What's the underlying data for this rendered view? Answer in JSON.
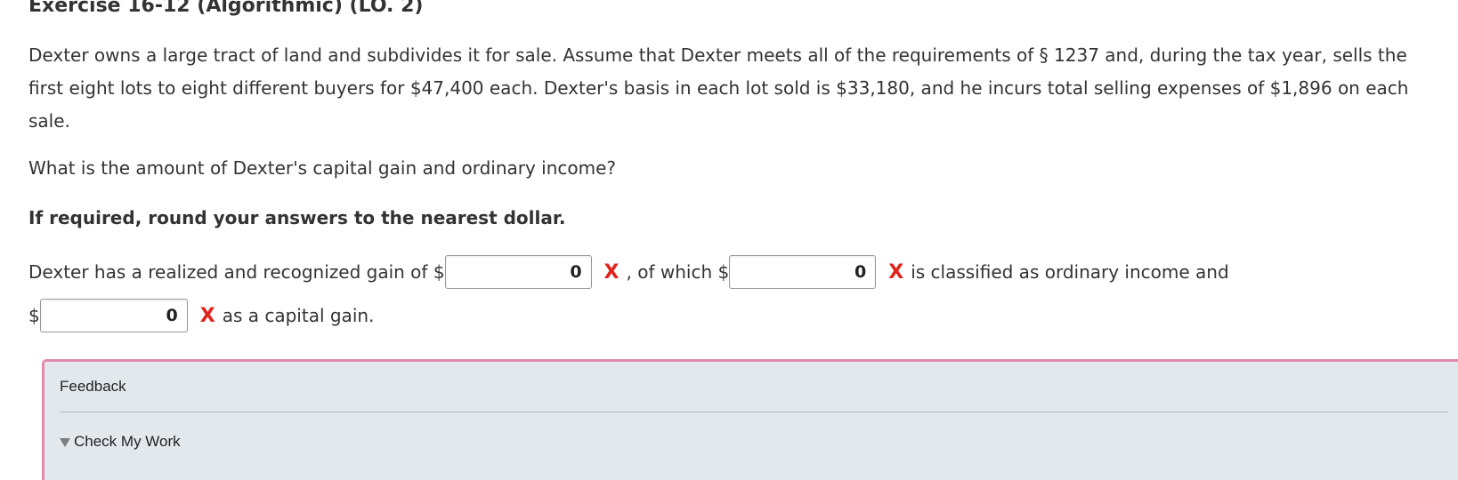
{
  "exercise": {
    "title": "Exercise 16-12 (Algorithmic) (LO. 2)"
  },
  "problem": {
    "paragraph1": "Dexter owns a large tract of land and subdivides it for sale. Assume that Dexter meets all of the requirements of § 1237 and, during the tax year, sells the first eight lots to eight different buyers for $47,400 each. Dexter's basis in each lot sold is $33,180, and he incurs total selling expenses of $1,896 on each sale.",
    "question": "What is the amount of Dexter's capital gain and ordinary income?",
    "instruction": "If required, round your answers to the nearest dollar."
  },
  "answer": {
    "text_before_gain": "Dexter has a realized and recognized gain of $",
    "gain_value": "0",
    "text_of_which": ", of which $",
    "ordinary_value": "0",
    "text_ordinary": "is classified as ordinary income and",
    "dollar_sign": "$",
    "capital_value": "0",
    "text_capital": "as a capital gain.",
    "incorrect_mark": "X"
  },
  "feedback": {
    "title": "Feedback",
    "check_label": "Check My Work"
  },
  "colors": {
    "incorrect": "#e0231c",
    "feedback_border": "#e28aac",
    "feedback_bg": "#e2e8ec"
  }
}
